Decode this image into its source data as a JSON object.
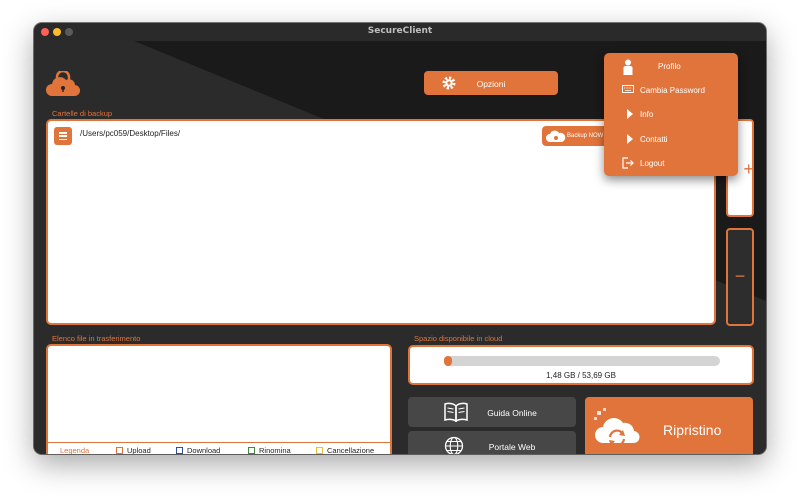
{
  "window": {
    "title": "SecureClient"
  },
  "toolbar": {
    "options_label": "Opzioni"
  },
  "profile_menu": {
    "header": "Profilo",
    "items": [
      {
        "label": "Cambia Password",
        "icon": "keyboard-icon"
      },
      {
        "label": "Info",
        "icon": "triangle-right-icon"
      },
      {
        "label": "Contatti",
        "icon": "triangle-right-icon"
      },
      {
        "label": "Logout",
        "icon": "logout-icon"
      }
    ]
  },
  "backup": {
    "section_label": "Cartelle di backup",
    "folder_path": "/Users/pc059/Desktop/Files/",
    "backup_now_label": "Backup NOW",
    "add_label": "+",
    "remove_label": "−"
  },
  "transfer": {
    "section_label": "Elenco file in trasferimento",
    "legend": {
      "title": "Legenda",
      "items": [
        {
          "label": "Upload",
          "color": "#e0743a"
        },
        {
          "label": "Download",
          "color": "#2c4ea3"
        },
        {
          "label": "Rinomina",
          "color": "#3d8a3d"
        },
        {
          "label": "Cancellazione",
          "color": "#e6c02e"
        }
      ]
    }
  },
  "cloud_space": {
    "section_label": "Spazio disponibile in cloud",
    "usage_text": "1,48 GB / 53,69 GB",
    "used_fraction": 0.028
  },
  "buttons": {
    "guide_label": "Guida Online",
    "portal_label": "Portale Web",
    "restore_label": "Ripristino"
  },
  "colors": {
    "accent": "#e0743a",
    "background": "#242424"
  }
}
